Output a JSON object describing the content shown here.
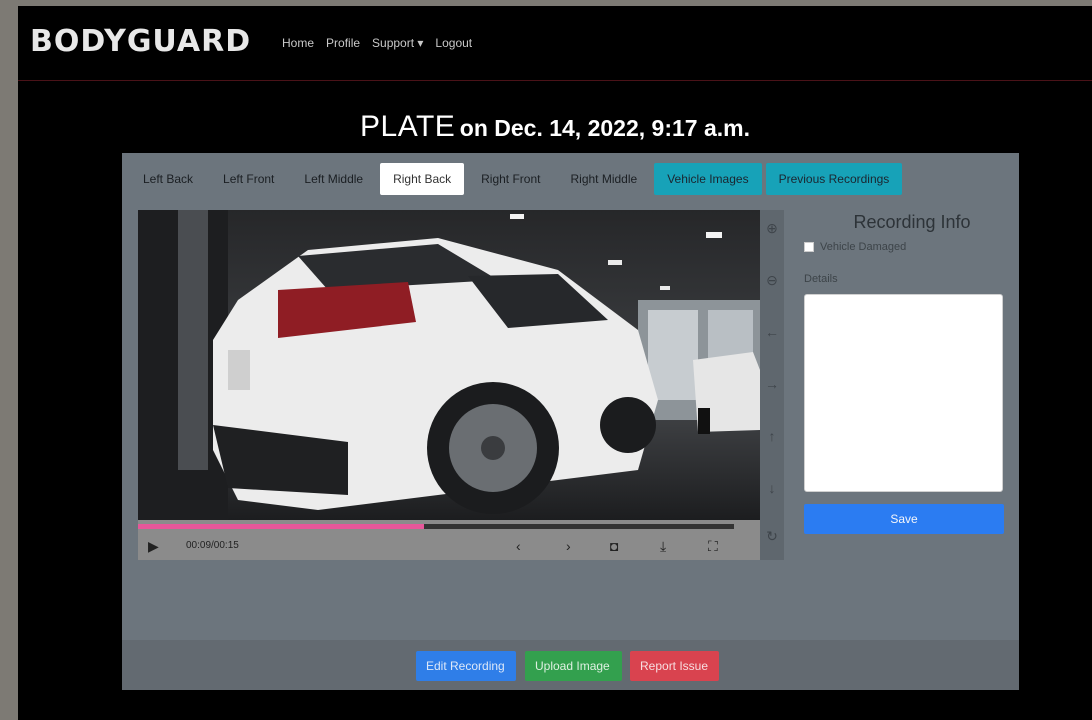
{
  "brand": "BODYGUARD",
  "nav": {
    "items": [
      "Home",
      "Profile",
      "Support ▾",
      "Logout"
    ]
  },
  "headline": {
    "plate": "PLATE",
    "date": "on Dec. 14, 2022, 9:17 a.m."
  },
  "tabs": [
    {
      "label": "Left Back",
      "style": "plain"
    },
    {
      "label": "Left Front",
      "style": "plain"
    },
    {
      "label": "Left Middle",
      "style": "plain"
    },
    {
      "label": "Right Back",
      "style": "active"
    },
    {
      "label": "Right Front",
      "style": "plain"
    },
    {
      "label": "Right Middle",
      "style": "plain"
    },
    {
      "label": "Vehicle Images",
      "style": "info"
    },
    {
      "label": "Previous Recordings",
      "style": "info"
    }
  ],
  "player": {
    "time": "00:09/00:15",
    "progress_fraction": 0.48,
    "icons": [
      "play-icon",
      "prev-frame-icon",
      "next-frame-icon",
      "camera-icon",
      "download-icon",
      "fullscreen-icon"
    ]
  },
  "tools": [
    "zoom-in-icon",
    "zoom-out-icon",
    "arrow-left-icon",
    "arrow-right-icon",
    "arrow-up-icon",
    "arrow-down-icon",
    "rotate-icon"
  ],
  "recording_info": {
    "title": "Recording Info",
    "checkbox_label": "Vehicle Damaged",
    "details_label": "Details",
    "details_value": "",
    "save_label": "Save"
  },
  "footer": {
    "edit_label": "Edit Recording",
    "upload_label": "Upload Image",
    "report_label": "Report Issue"
  },
  "colors": {
    "primary": "#2f7ee8",
    "success": "#33a04e",
    "danger": "#d9434f",
    "info": "#17a2b8",
    "progress": "#e6579a",
    "panel": "#6c757d"
  }
}
